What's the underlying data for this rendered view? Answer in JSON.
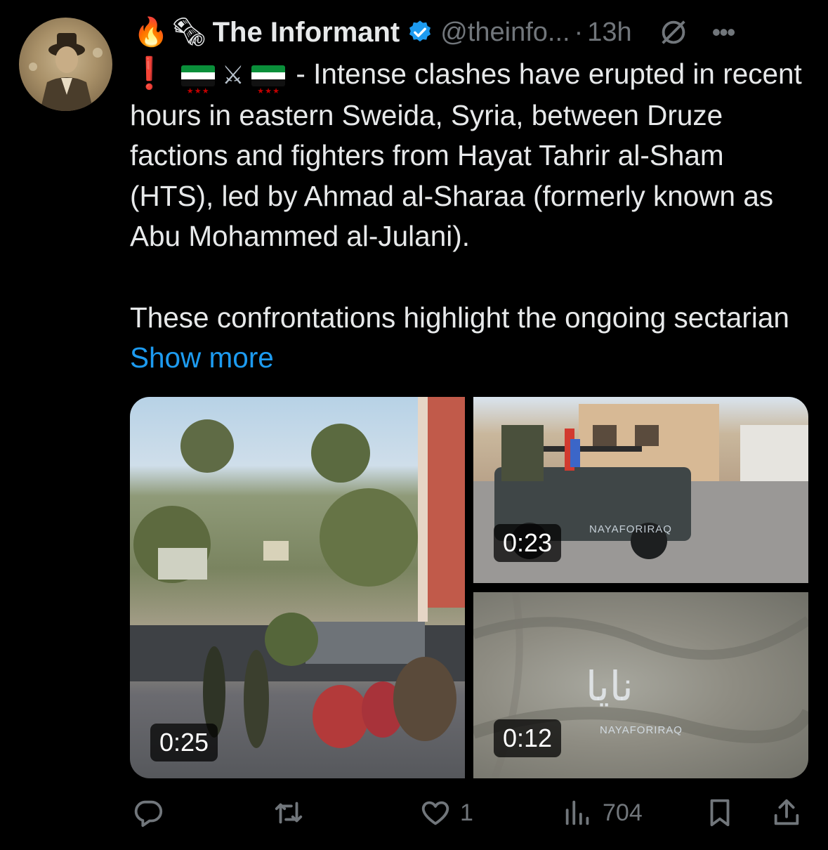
{
  "author": {
    "emojis": [
      "🔥",
      "🗞"
    ],
    "name": "The Informant",
    "handle": "@theinfo...",
    "separator": "·",
    "time": "13h"
  },
  "tweet": {
    "prefix_emoji": "❗",
    "swords_emoji": "⚔",
    "line1_text": " - Intense clashes have erupted in recent hours in eastern Sweida, Syria, between Druze factions and fighters from Hayat Tahrir al-Sham (HTS), led by Ahmad al-Sharaa (formerly known as Abu Mohammed al-Julani).",
    "para2_text": "These confrontations highlight the ongoing sectarian ",
    "show_more": "Show more"
  },
  "media": [
    {
      "duration": "0:25"
    },
    {
      "duration": "0:23",
      "watermark": "NAYAFORIRAQ"
    },
    {
      "duration": "0:12",
      "watermark": "NAYAFORIRAQ",
      "overlay_text": "نايا"
    }
  ],
  "actions": {
    "reply_count": "",
    "retweet_count": "",
    "like_count": "1",
    "views_count": "704"
  },
  "colors": {
    "accent": "#1d9bf0",
    "muted": "#71767b",
    "text": "#e7e9ea",
    "background": "#000000"
  },
  "icons": [
    "verified-badge-icon",
    "grok-icon",
    "more-icon",
    "reply-icon",
    "retweet-icon",
    "like-icon",
    "views-icon",
    "bookmark-icon",
    "share-icon"
  ]
}
